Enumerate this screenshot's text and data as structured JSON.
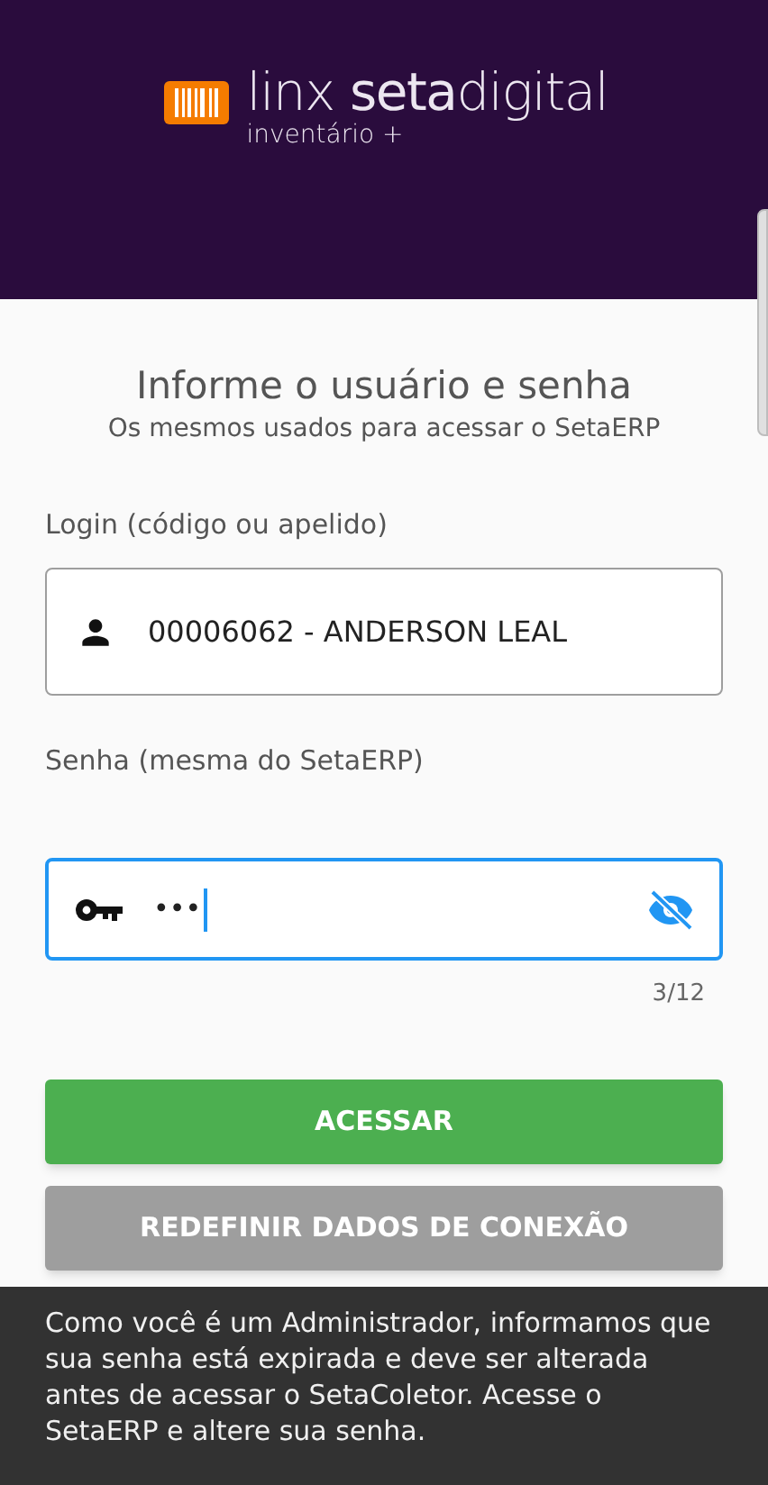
{
  "header": {
    "logo_text": "linx **seta**digital",
    "logo_subtitle": "inventário +"
  },
  "heading": {
    "title": "Informe o usuário e senha",
    "subtitle": "Os mesmos usados para acessar o SetaERP"
  },
  "login": {
    "label": "Login (código ou apelido)",
    "value": "00006062 - ANDERSON LEAL",
    "focused": false
  },
  "password": {
    "label": "Senha (mesma do SetaERP)",
    "value": "•••",
    "focused": true,
    "visible": false,
    "counter": "3/12"
  },
  "buttons": [
    {
      "label": "ACESSAR",
      "kind": "primary"
    },
    {
      "label": "REDEFINIR DADOS DE CONEXÃO",
      "kind": "secondary"
    }
  ],
  "snackbar": {
    "message": "Como você é um Administrador, informamos que sua senha está expirada e deve ser alterada antes de acessar o SetaColetor. Acesse o SetaERP e altere sua senha."
  }
}
